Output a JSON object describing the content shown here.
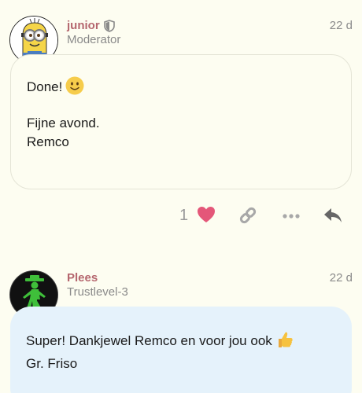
{
  "posts": [
    {
      "username": "junior",
      "user_title": "Moderator",
      "date": "22 d",
      "paragraphs": [
        [
          "Done!"
        ],
        [
          "Fijne avond.",
          "Remco"
        ]
      ],
      "like_count": "1",
      "icons": [
        "heart-icon",
        "link-icon",
        "more-icon",
        "reply-icon"
      ]
    },
    {
      "username": "Plees",
      "user_title": "Trustlevel-3",
      "date": "22 d",
      "paragraphs": [
        [
          "Super! Dankjewel Remco en voor jou ook",
          "Gr. Friso"
        ]
      ]
    }
  ],
  "colors": {
    "background": "#fdfdf1",
    "username": "#b5666e",
    "muted": "#8a8a8a",
    "highlight_bubble": "#e5f2fb",
    "heart": "#e45779"
  }
}
